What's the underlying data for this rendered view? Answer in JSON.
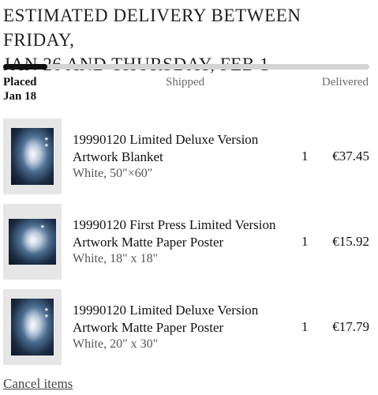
{
  "delivery": {
    "line1": "Estimated delivery between Friday,",
    "line2": "Jan 26 and Thursday, Feb 1"
  },
  "progress": {
    "value": 0.12,
    "steps": [
      {
        "label": "Placed",
        "date": "Jan 18",
        "active": true
      },
      {
        "label": "Shipped",
        "active": false
      },
      {
        "label": "Delivered",
        "active": false
      }
    ]
  },
  "items": [
    {
      "name": "19990120 Limited Deluxe Version Artwork Blanket",
      "variant": "White, 50″×60″",
      "quantity": "1",
      "price": "€37.45",
      "image_icon": "album-artwork-thumbnail"
    },
    {
      "name": "19990120 First Press Limited Version Artwork Matte Paper Poster",
      "variant": "White, 18\" x 18\"",
      "quantity": "1",
      "price": "€15.92",
      "image_icon": "album-artwork-thumbnail"
    },
    {
      "name": "19990120 Limited Deluxe Version Artwork Matte Paper Poster",
      "variant": "White, 20\" x 30\"",
      "quantity": "1",
      "price": "€17.79",
      "image_icon": "album-artwork-thumbnail"
    }
  ],
  "actions": {
    "cancel_label": "Cancel items"
  },
  "colors": {
    "progress_fill": "#111111",
    "progress_track": "#d4d4d4",
    "muted_text": "#6b6b6b"
  }
}
